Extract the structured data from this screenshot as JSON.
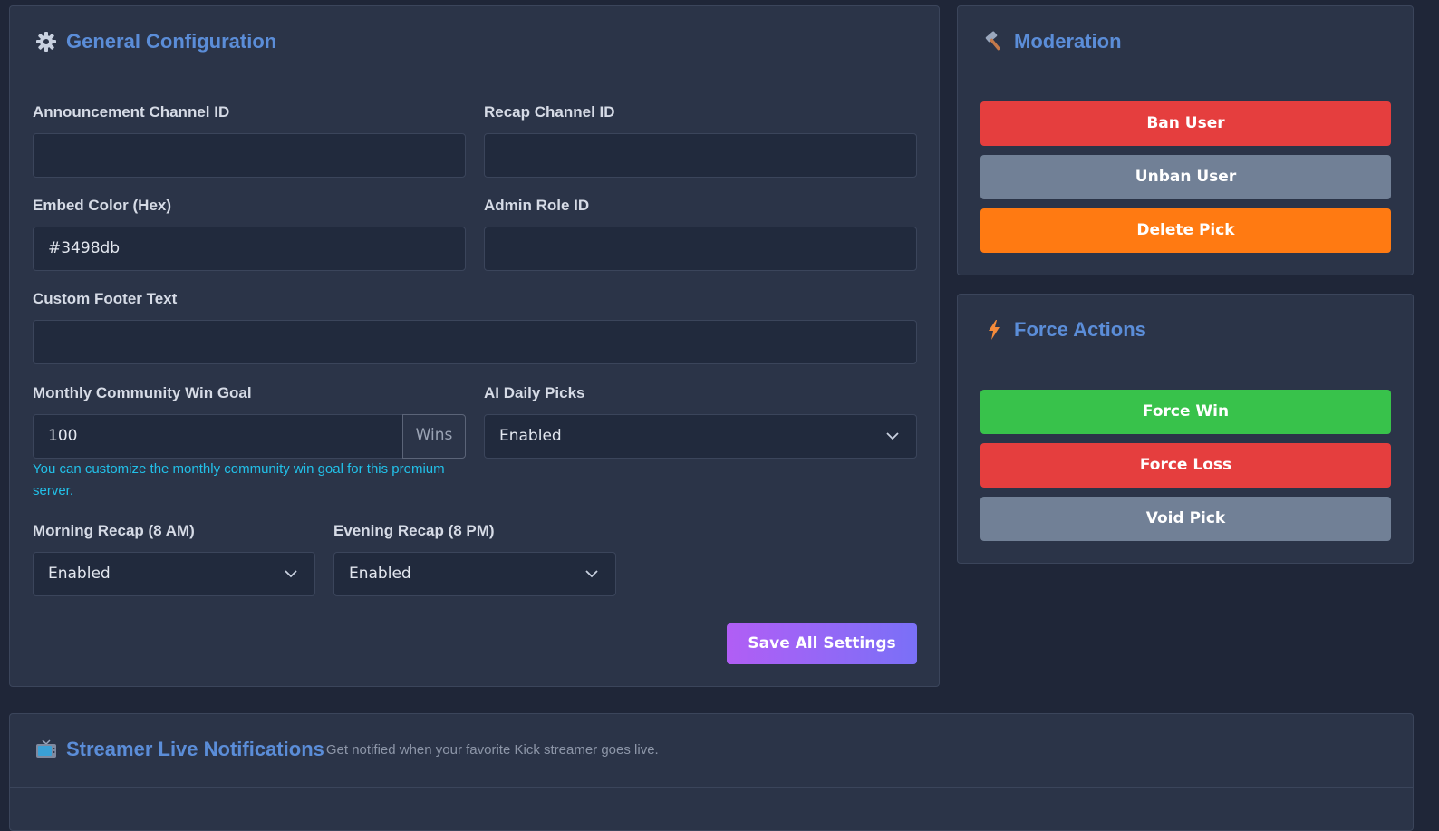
{
  "general": {
    "title": "General Configuration",
    "icon": "gear-icon",
    "fields": {
      "announcement_label": "Announcement Channel ID",
      "announcement_value": "",
      "recap_label": "Recap Channel ID",
      "recap_value": "",
      "embed_label": "Embed Color (Hex)",
      "embed_value": "#3498db",
      "admin_label": "Admin Role ID",
      "admin_value": "",
      "footer_label": "Custom Footer Text",
      "footer_value": "",
      "goal_label": "Monthly Community Win Goal",
      "goal_value": "100",
      "goal_addon": "Wins",
      "goal_help": "You can customize the monthly community win goal for this premium server.",
      "ai_label": "AI Daily Picks",
      "ai_value": "Enabled",
      "morning_label": "Morning Recap (8 AM)",
      "morning_value": "Enabled",
      "evening_label": "Evening Recap (8 PM)",
      "evening_value": "Enabled"
    },
    "save_label": "Save All Settings"
  },
  "moderation": {
    "title": "Moderation",
    "icon": "hammer-icon",
    "ban_label": "Ban User",
    "unban_label": "Unban User",
    "delete_label": "Delete Pick"
  },
  "force": {
    "title": "Force Actions",
    "icon": "lightning-icon",
    "win_label": "Force Win",
    "loss_label": "Force Loss",
    "void_label": "Void Pick"
  },
  "streamer": {
    "title": "Streamer Live Notifications",
    "icon": "tv-icon",
    "subtitle": "Get notified when your favorite Kick streamer goes live."
  },
  "colors": {
    "accent": "#5b8dd8",
    "danger": "#e53e3e",
    "secondary": "#718096",
    "warning": "#ff7a12",
    "success": "#38c24b",
    "save_gradient_start": "#b15ef5",
    "save_gradient_end": "#7a70f7"
  }
}
